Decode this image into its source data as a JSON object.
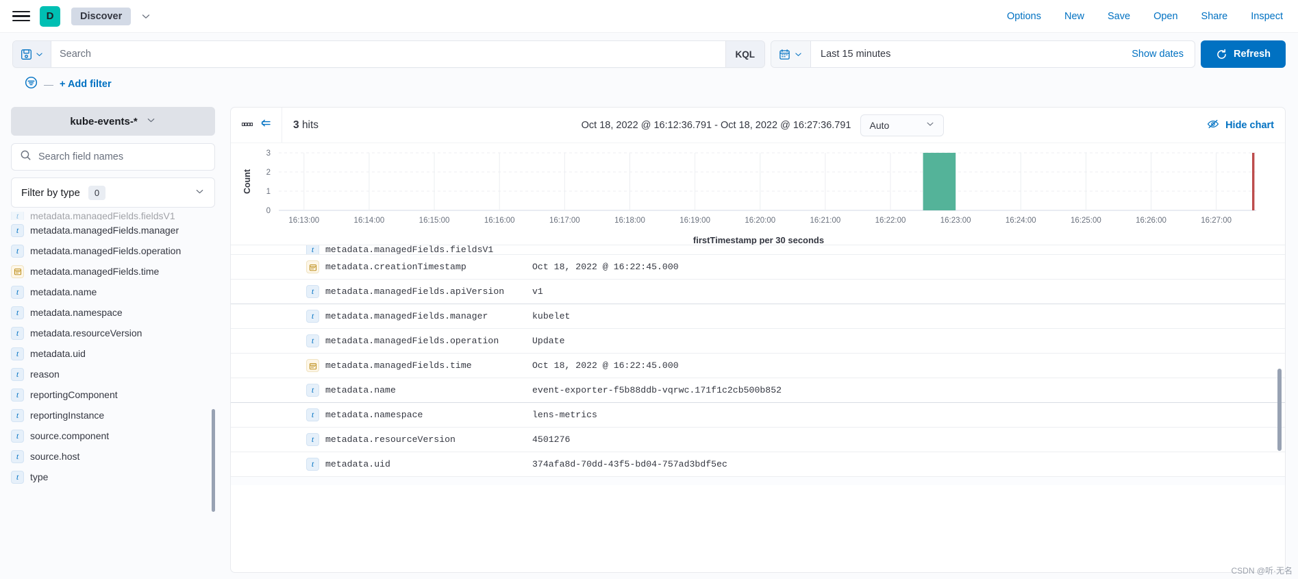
{
  "topnav": {
    "menu_icon": "hamburger-icon",
    "space_initial": "D",
    "breadcrumb": "Discover",
    "links": [
      "Options",
      "New",
      "Save",
      "Open",
      "Share",
      "Inspect"
    ]
  },
  "query": {
    "saved_query_icon": "save-disk-icon",
    "placeholder": "Search",
    "value": "",
    "language_badge": "KQL",
    "date_icon": "calendar-icon",
    "date_range": "Last 15 minutes",
    "show_dates": "Show dates",
    "refresh": "Refresh",
    "refresh_icon": "refresh-icon",
    "filter_icon": "filter-icon",
    "filter_dash": "—",
    "add_filter": "+ Add filter"
  },
  "sidebar": {
    "index_pattern": "kube-events-*",
    "field_search_placeholder": "Search field names",
    "search_icon": "search-icon",
    "filter_by_type_label": "Filter by type",
    "filter_by_type_count": "0",
    "fields": [
      {
        "name": "metadata.managedFields.fieldsV1",
        "type": "t",
        "clipped": true
      },
      {
        "name": "metadata.managedFields.manager",
        "type": "t"
      },
      {
        "name": "metadata.managedFields.operation",
        "type": "t"
      },
      {
        "name": "metadata.managedFields.time",
        "type": "date"
      },
      {
        "name": "metadata.name",
        "type": "t"
      },
      {
        "name": "metadata.namespace",
        "type": "t"
      },
      {
        "name": "metadata.resourceVersion",
        "type": "t"
      },
      {
        "name": "metadata.uid",
        "type": "t"
      },
      {
        "name": "reason",
        "type": "t"
      },
      {
        "name": "reportingComponent",
        "type": "t"
      },
      {
        "name": "reportingInstance",
        "type": "t"
      },
      {
        "name": "source.component",
        "type": "t"
      },
      {
        "name": "source.host",
        "type": "t"
      },
      {
        "name": "type",
        "type": "t"
      }
    ]
  },
  "main": {
    "hits_count": "3",
    "hits_label": "hits",
    "time_range": "Oct 18, 2022 @ 16:12:36.791 - Oct 18, 2022 @ 16:27:36.791",
    "interval": "Auto",
    "hide_chart": "Hide chart",
    "hide_chart_icon": "eye-slash-icon",
    "collapse_icon": "collapse-left-icon",
    "grid_icon": "grid-dots-icon"
  },
  "chart_data": {
    "type": "bar",
    "title": "",
    "xlabel": "firstTimestamp per 30 seconds",
    "ylabel": "Count",
    "ylim": [
      0,
      3
    ],
    "yticks": [
      0,
      1,
      2,
      3
    ],
    "xticks": [
      "16:13:00",
      "16:14:00",
      "16:15:00",
      "16:16:00",
      "16:17:00",
      "16:18:00",
      "16:19:00",
      "16:20:00",
      "16:21:00",
      "16:22:00",
      "16:23:00",
      "16:24:00",
      "16:25:00",
      "16:26:00",
      "16:27:00"
    ],
    "bar_color": "#54b399",
    "marker_color": "#bd4c4c",
    "grid": true,
    "legend": "none",
    "categories": [
      "16:22:30",
      "16:27:30"
    ],
    "values": [
      3,
      0
    ],
    "bars": [
      {
        "x": "16:22:30",
        "value": 3
      }
    ],
    "annotations": [
      {
        "name": "current-time-marker",
        "x": "16:27:36.791",
        "color": "#bd4c4c"
      }
    ]
  },
  "doc_table": {
    "rows": [
      {
        "field": "metadata.managedFields.fieldsV1",
        "type": "t",
        "value": "",
        "partial": true
      },
      {
        "field": "metadata.creationTimestamp",
        "type": "date",
        "value": "Oct 18, 2022 @ 16:22:45.000"
      },
      {
        "field": "metadata.managedFields.apiVersion",
        "type": "t",
        "value": "v1"
      },
      {
        "field": "metadata.managedFields.manager",
        "type": "t",
        "value": "kubelet"
      },
      {
        "field": "metadata.managedFields.operation",
        "type": "t",
        "value": "Update"
      },
      {
        "field": "metadata.managedFields.time",
        "type": "date",
        "value": "Oct 18, 2022 @ 16:22:45.000"
      },
      {
        "field": "metadata.name",
        "type": "t",
        "value": "event-exporter-f5b88ddb-vqrwc.171f1c2cb500b852"
      },
      {
        "field": "metadata.namespace",
        "type": "t",
        "value": "lens-metrics"
      },
      {
        "field": "metadata.resourceVersion",
        "type": "t",
        "value": "4501276"
      },
      {
        "field": "metadata.uid",
        "type": "t",
        "value": "374afa8d-70dd-43f5-bd04-757ad3bdf5ec"
      }
    ]
  },
  "watermark": "CSDN @听·无名"
}
